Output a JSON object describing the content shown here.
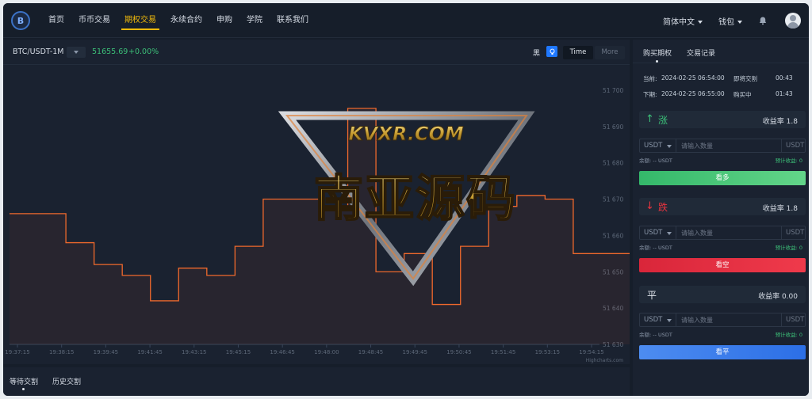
{
  "nav": {
    "items": [
      "首页",
      "币币交易",
      "期权交易",
      "永续合约",
      "申购",
      "学院",
      "联系我们"
    ],
    "active": 2,
    "language": "简体中文",
    "wallet": "钱包"
  },
  "toolbar": {
    "pair": "BTC/USDT-1M",
    "price": "51655.69",
    "change": "+0.00%",
    "theme_label": "黑",
    "time_label": "Time",
    "more_label": "More"
  },
  "chart_data": {
    "type": "line",
    "y_ticks": [
      "51 700",
      "51 690",
      "51 680",
      "51 670",
      "51 660",
      "51 650",
      "51 640",
      "51 630"
    ],
    "x_ticks": [
      "19:37:15",
      "19:38:15",
      "19:39:45",
      "19:41:45",
      "19:43:15",
      "19:45:15",
      "19:46:45",
      "19:48:00",
      "19:48:45",
      "19:49:45",
      "19:50:45",
      "19:51:45",
      "19:53:15",
      "19:54:15"
    ],
    "ylim": [
      51630,
      51705
    ],
    "series": [
      {
        "values": [
          51666,
          51666,
          51658,
          51652,
          51649,
          51642,
          51651,
          51649,
          51657,
          51670,
          51670,
          51668,
          51695,
          51650,
          51655,
          51641,
          51657,
          51668,
          51671,
          51670,
          51655,
          51655
        ]
      }
    ],
    "credit": "Highcharts.com"
  },
  "side": {
    "tabs": [
      "购买期权",
      "交易记录"
    ],
    "current_label": "当前:",
    "current_time": "2024-02-25 06:54:00",
    "current_status": "即将交割",
    "current_countdown": "00:43",
    "next_label": "下期:",
    "next_time": "2024-02-25 06:55:00",
    "next_status": "购买中",
    "next_countdown": "01:43",
    "up": {
      "arrow": "↑",
      "label": "涨",
      "rate_label": "收益率",
      "rate": "1.8",
      "button": "看多",
      "color": "#3cbf78"
    },
    "down": {
      "arrow": "↓",
      "label": "跌",
      "rate_label": "收益率",
      "rate": "1.8",
      "button": "看空",
      "color": "#e8343f"
    },
    "flat": {
      "label": "平",
      "rate_label": "收益率",
      "rate": "0.00",
      "button": "看平"
    },
    "currency": "USDT",
    "placeholder": "请输入数量",
    "balance_label": "余额:",
    "balance_value": "-- USDT",
    "expected_label": "预计收益:",
    "expected_value": "0"
  },
  "bottom": {
    "tabs": [
      "等待交割",
      "历史交割"
    ]
  },
  "watermark": {
    "site": "KVXR.COM",
    "text": "南亚源码"
  }
}
